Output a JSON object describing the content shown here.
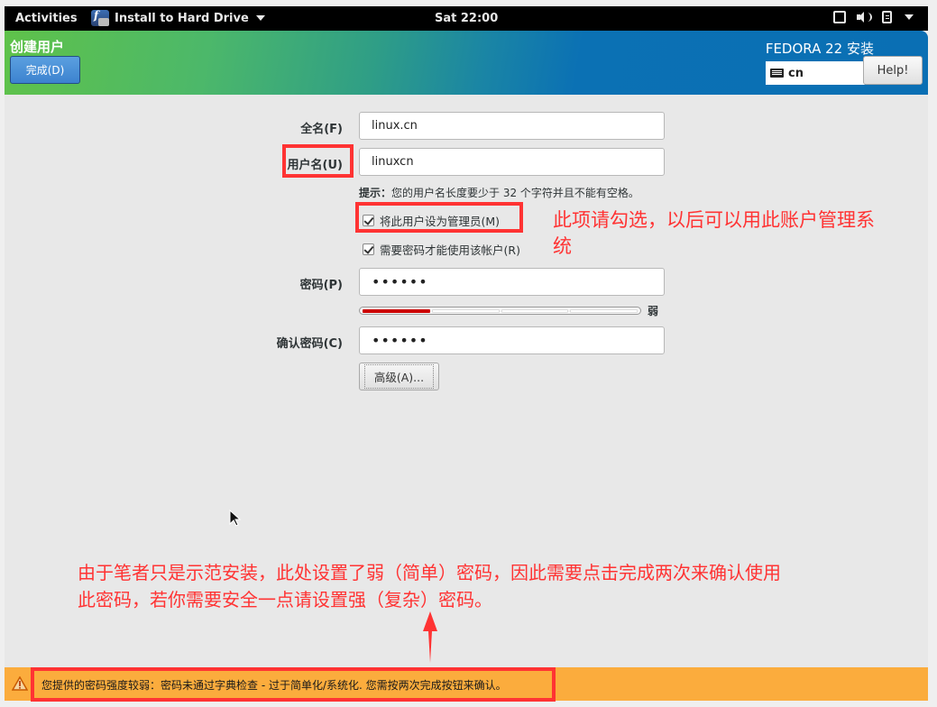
{
  "topbar": {
    "activities": "Activities",
    "app_name": "Install to Hard Drive",
    "clock": "Sat 22:00",
    "tray_icons": [
      "window-icon",
      "volume-icon",
      "clipboard-battery-icon",
      "chevron-down-icon"
    ]
  },
  "header": {
    "title": "创建用户",
    "done_button": "完成(D)",
    "product": "FEDORA 22 安装",
    "keyboard_layout": "cn",
    "help_button": "Help!"
  },
  "form": {
    "fullname": {
      "label": "全名(F)",
      "value": "linux.cn"
    },
    "username": {
      "label": "用户名(U)",
      "value": "linuxcn"
    },
    "hint_prefix": "提示：",
    "hint_text": "您的用户名长度要少于 32 个字符并且不能有空格。",
    "admin_checkbox": {
      "label": "将此用户设为管理员(M)",
      "checked": true
    },
    "require_password_checkbox": {
      "label": "需要密码才能使用该帐户(R)",
      "checked": true
    },
    "password": {
      "label": "密码(P)",
      "value": "••••••"
    },
    "strength": {
      "segments": 4,
      "filled": 1,
      "label": "弱",
      "color": "#cc0000"
    },
    "confirm": {
      "label": "确认密码(C)",
      "value": "••••••"
    },
    "advanced_button": "高级(A)..."
  },
  "annotations": {
    "admin_note": "此项请勾选，以后可以用此账户管理系统",
    "admin_note_line1": "此项请勾选，以后可以用此账户管理系",
    "admin_note_line2": "统",
    "password_note_line1": "由于笔者只是示范安装，此处设置了弱（简单）密码，因此需要点击完成两次来确认使用",
    "password_note_line2": "此密码，若你需要安全一点请设置强（复杂）密码。",
    "highlight_color": "#ff3333"
  },
  "warning_bar": {
    "text": "您提供的密码强度较弱：密码未通过字典检查 - 过于简单化/系统化. 您需按两次完成按钮来确认。",
    "color": "#fbac3d"
  }
}
